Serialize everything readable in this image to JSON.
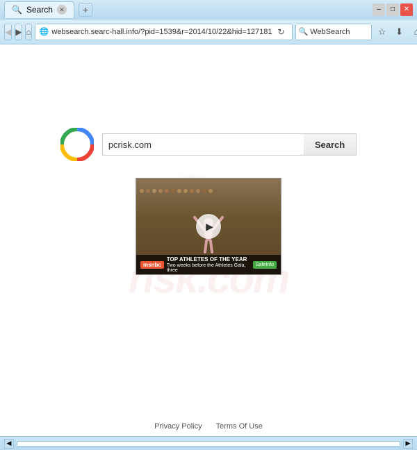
{
  "window": {
    "title": "Search",
    "tab": {
      "label": "Search",
      "favicon": "🔍"
    }
  },
  "titlebar": {
    "controls": {
      "minimize": "–",
      "maximize": "□",
      "close": "✕"
    },
    "new_tab": "+"
  },
  "navbar": {
    "back": "◀",
    "forward": "▶",
    "home": "⌂",
    "address": "websearch.searc-hall.info/?pid=1539&r=2014/10/22&hid=127181",
    "address_icon": "🔒",
    "refresh": "↻",
    "search_placeholder": "WebSearch",
    "icons": {
      "star": "☆",
      "download": "⬇",
      "home2": "⌂",
      "menu": "☰"
    }
  },
  "page": {
    "search_input_value": "pcrisk.com",
    "search_button_label": "Search",
    "video": {
      "bar_logo": "msnbc",
      "title": "TOP ATHLETES OF THE YEAR",
      "description": "Two weeks before the Athletes Gala, three",
      "safeinfo": "SafeInfo"
    },
    "footer": {
      "privacy_policy": "Privacy Policy",
      "terms_of_use": "Terms Of Use"
    }
  },
  "statusbar": {
    "scroll_left": "◀",
    "scroll_right": "▶"
  }
}
